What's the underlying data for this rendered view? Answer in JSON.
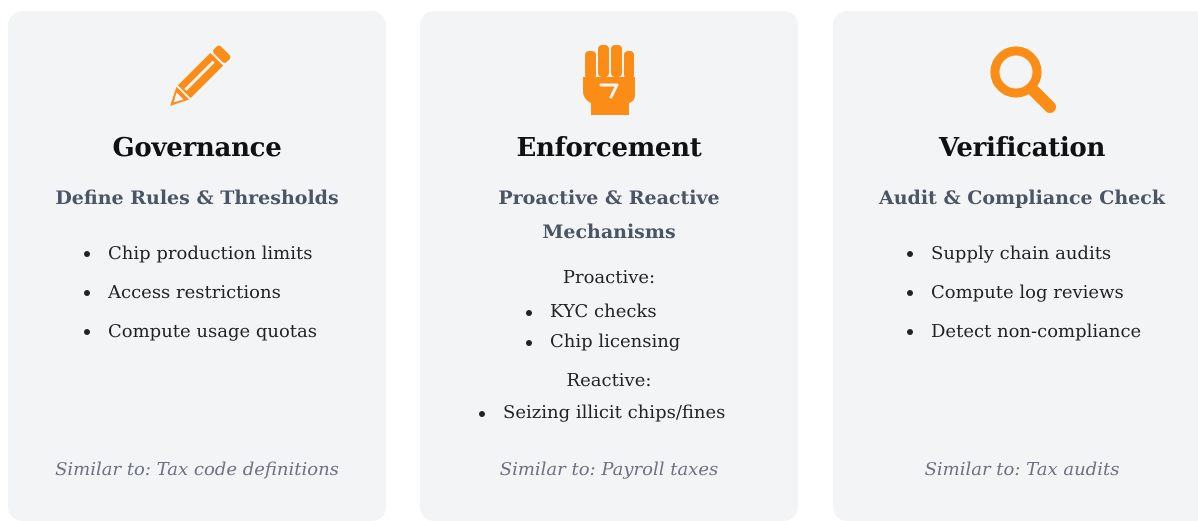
{
  "accent_color": "#fb8c16",
  "cards": [
    {
      "icon": "pencil-icon",
      "title": "Governance",
      "subtitle": "Define Rules & Thresholds",
      "items": [
        "Chip production limits",
        "Access restrictions",
        "Compute usage quotas"
      ],
      "footer": "Similar to: Tax code definitions"
    },
    {
      "icon": "fist-icon",
      "title": "Enforcement",
      "subtitle": "Proactive & Reactive Mechanisms",
      "groups": [
        {
          "label": "Proactive:",
          "items": [
            "KYC checks",
            "Chip licensing"
          ]
        },
        {
          "label": "Reactive:",
          "items": [
            "Seizing illicit chips/fines"
          ]
        }
      ],
      "footer": "Similar to: Payroll taxes"
    },
    {
      "icon": "magnifying-glass-icon",
      "title": "Verification",
      "subtitle": "Audit & Compliance Check",
      "items": [
        "Supply chain audits",
        "Compute log reviews",
        "Detect non-compliance"
      ],
      "footer": "Similar to: Tax audits"
    }
  ]
}
